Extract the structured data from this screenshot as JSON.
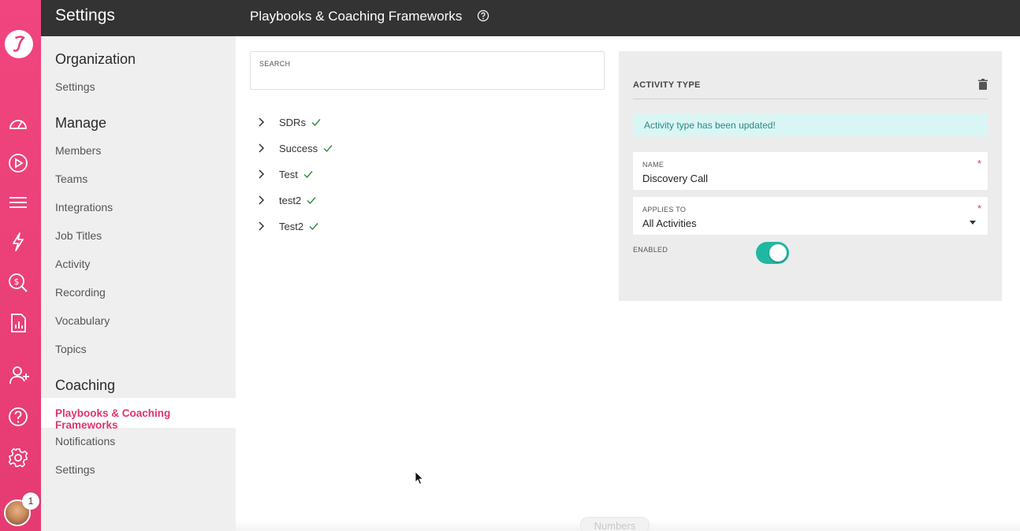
{
  "app": {
    "settings_title": "Settings",
    "page_title": "Playbooks & Coaching Frameworks"
  },
  "rail": {
    "icons": [
      "logo-icon",
      "dashboard-icon",
      "play-icon",
      "list-icon",
      "lightning-icon",
      "deal-search-icon",
      "report-icon",
      "add-user-icon",
      "help-icon",
      "gear-icon"
    ],
    "notification_count": "1"
  },
  "sidenav": {
    "sections": [
      {
        "title": "Organization",
        "items": [
          "Settings"
        ]
      },
      {
        "title": "Manage",
        "items": [
          "Members",
          "Teams",
          "Integrations",
          "Job Titles",
          "Activity",
          "Recording",
          "Vocabulary",
          "Topics"
        ]
      },
      {
        "title": "Coaching",
        "items": [
          "Playbooks & Coaching Frameworks",
          "Notifications",
          "Settings"
        ]
      }
    ],
    "active_item": "Playbooks & Coaching Frameworks"
  },
  "search": {
    "label": "SEARCH",
    "value": ""
  },
  "tree": {
    "items": [
      "SDRs",
      "Success",
      "Test",
      "test2",
      "Test2"
    ]
  },
  "panel": {
    "header": "ACTIVITY TYPE",
    "alert": "Activity type has been updated!",
    "name_label": "NAME",
    "name_value": "Discovery Call",
    "applies_label": "APPLIES TO",
    "applies_value": "All Activities",
    "required_mark": "*",
    "enabled_label": "ENABLED",
    "enabled": true
  },
  "footer": {
    "chip": "Numbers"
  },
  "colors": {
    "accent": "#e0336f",
    "rail": "#ea3f77",
    "toggle_on": "#20b8a3",
    "topbar": "#333333"
  }
}
